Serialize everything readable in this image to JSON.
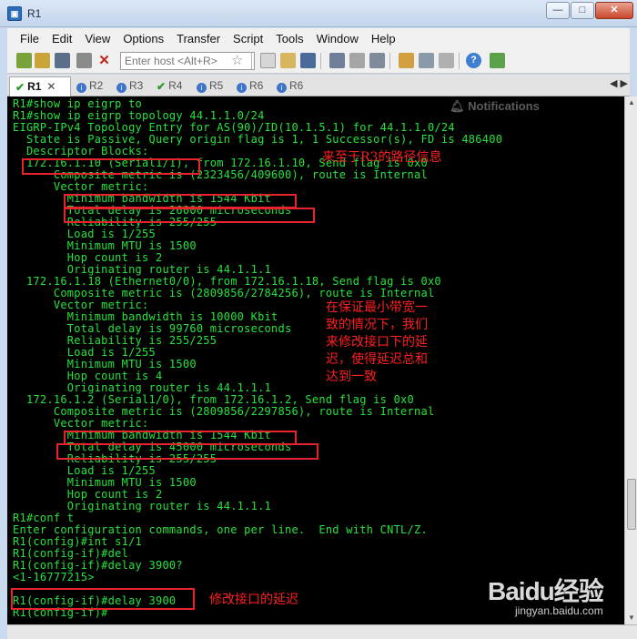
{
  "window": {
    "title": "R1",
    "app_icon": "securecrt-icon"
  },
  "menu": [
    "File",
    "Edit",
    "View",
    "Options",
    "Transfer",
    "Script",
    "Tools",
    "Window",
    "Help"
  ],
  "toolbar": {
    "host_placeholder": "Enter host <Alt+R>"
  },
  "tabs": [
    {
      "label": "R1",
      "state": "connected",
      "active": true
    },
    {
      "label": "R2",
      "state": "info"
    },
    {
      "label": "R3",
      "state": "info"
    },
    {
      "label": "R4",
      "state": "connected"
    },
    {
      "label": "R5",
      "state": "info"
    },
    {
      "label": "R6",
      "state": "info"
    },
    {
      "label": "R6",
      "state": "info"
    }
  ],
  "notifications_label": "Notifications",
  "terminal": {
    "lines": [
      "R1#show ip eigrp to",
      "R1#show ip eigrp topology 44.1.1.0/24",
      "EIGRP-IPv4 Topology Entry for AS(90)/ID(10.1.5.1) for 44.1.1.0/24",
      "  State is Passive, Query origin flag is 1, 1 Successor(s), FD is 486400",
      "  Descriptor Blocks:",
      "  172.16.1.10 (Serial1/1), from 172.16.1.10, Send flag is 0x0",
      "      Composite metric is (2323456/409600), route is Internal",
      "      Vector metric:",
      "        Minimum bandwidth is 1544 Kbit",
      "        Total delay is 26000 microseconds",
      "        Reliability is 255/255",
      "        Load is 1/255",
      "        Minimum MTU is 1500",
      "        Hop count is 2",
      "        Originating router is 44.1.1.1",
      "  172.16.1.18 (Ethernet0/0), from 172.16.1.18, Send flag is 0x0",
      "      Composite metric is (2809856/2784256), route is Internal",
      "      Vector metric:",
      "        Minimum bandwidth is 10000 Kbit",
      "        Total delay is 99760 microseconds",
      "        Reliability is 255/255",
      "        Load is 1/255",
      "        Minimum MTU is 1500",
      "        Hop count is 4",
      "        Originating router is 44.1.1.1",
      "  172.16.1.2 (Serial1/0), from 172.16.1.2, Send flag is 0x0",
      "      Composite metric is (2809856/2297856), route is Internal",
      "      Vector metric:",
      "        Minimum bandwidth is 1544 Kbit",
      "        Total delay is 45000 microseconds",
      "        Reliability is 255/255",
      "        Load is 1/255",
      "        Minimum MTU is 1500",
      "        Hop count is 2",
      "        Originating router is 44.1.1.1",
      "R1#conf t",
      "Enter configuration commands, one per line.  End with CNTL/Z.",
      "R1(config)#int s1/1",
      "R1(config-if)#del",
      "R1(config-if)#delay 3900?",
      "<1-16777215>",
      "",
      "R1(config-if)#delay 3900",
      "R1(config-if)#"
    ],
    "annotations": {
      "r3_path": "来至于R3的路径信息",
      "explain_l1": "在保证最小带宽一",
      "explain_l2": "致的情况下，我们",
      "explain_l3": "来修改接口下的延",
      "explain_l4": "迟，使得延迟总和",
      "explain_l5": "达到一致",
      "modify_delay": "修改接口的延迟"
    }
  },
  "watermark": {
    "logo": "Baidu经验",
    "url": "jingyan.baidu.com"
  }
}
